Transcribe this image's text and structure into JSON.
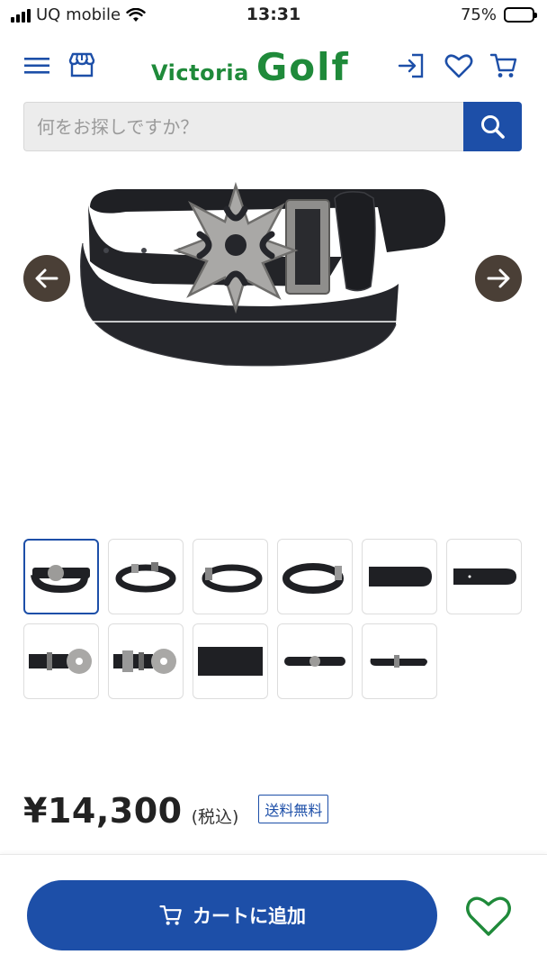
{
  "status_bar": {
    "carrier": "UQ mobile",
    "time": "13:31",
    "battery": "75%",
    "battery_level": 0.75
  },
  "header": {
    "logo_victoria": "Victoria",
    "logo_golf": "Golf",
    "icons": [
      "menu-icon",
      "store-icon",
      "login-icon",
      "heart-icon",
      "cart-icon"
    ]
  },
  "search": {
    "placeholder": "何をお探しですか？"
  },
  "gallery": {
    "thumbnail_count": 11,
    "selected_index": 0
  },
  "product": {
    "price": "¥14,300",
    "tax_note": "(税込)",
    "shipping_badge": "送料無料"
  },
  "actions": {
    "add_to_cart": "カートに追加"
  },
  "colors": {
    "accent": "#1d4fa8",
    "brand_green": "#1f8a3a",
    "arrow_bg": "#4a3f36"
  }
}
